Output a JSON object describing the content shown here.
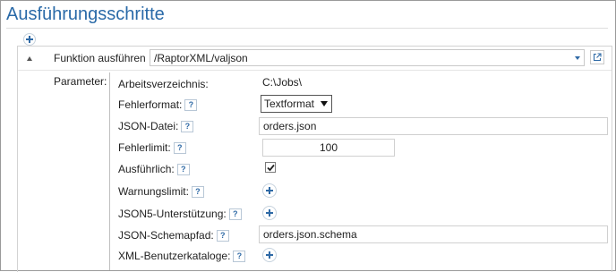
{
  "title": "Ausführungsschritte",
  "function": {
    "label": "Funktion ausführen",
    "value": "/RaptorXML/valjson"
  },
  "parameters": {
    "section_label": "Parameter:",
    "working_dir": {
      "label": "Arbeitsverzeichnis:",
      "value": "C:\\Jobs\\"
    },
    "error_format": {
      "label": "Fehlerformat:",
      "help": "?",
      "value": "Textformat"
    },
    "json_file": {
      "label": "JSON-Datei:",
      "help": "?",
      "value": "orders.json"
    },
    "error_limit": {
      "label": "Fehlerlimit:",
      "help": "?",
      "value": "100"
    },
    "verbose": {
      "label": "Ausführlich:",
      "help": "?",
      "checked": true
    },
    "warning_limit": {
      "label": "Warnungslimit:",
      "help": "?"
    },
    "json5_support": {
      "label": "JSON5-Unterstützung:",
      "help": "?"
    },
    "schema_path": {
      "label": "JSON-Schemapfad:",
      "help": "?",
      "value": "orders.json.schema"
    },
    "xml_catalogs": {
      "label": "XML-Benutzerkataloge:",
      "help": "?"
    }
  },
  "colors": {
    "title": "#2a6aa8",
    "accent": "#2f6aa6"
  },
  "icons": {
    "add_step": "plus-icon",
    "expand": "triangle-up-icon",
    "dropdown": "chevron-down-icon",
    "open_external": "external-link-icon",
    "checkbox": "checkmark-icon"
  }
}
